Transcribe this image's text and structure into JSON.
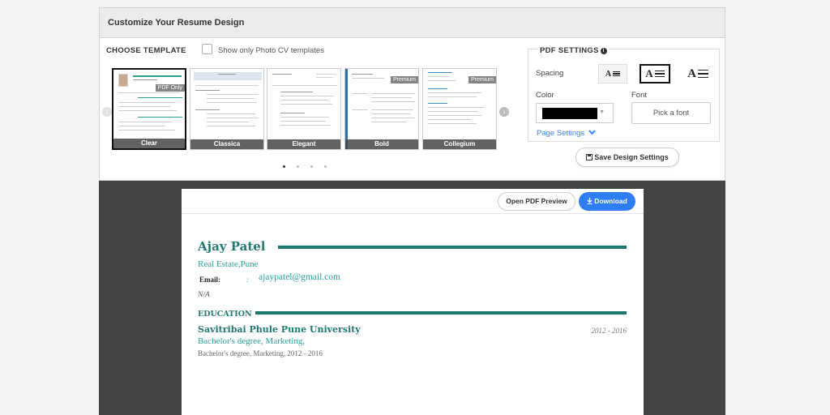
{
  "panel": {
    "title": "Customize Your Resume Design"
  },
  "templates": {
    "label": "CHOOSE TEMPLATE",
    "photo_only_label": "Show only Photo CV templates",
    "items": [
      {
        "name": "Clear",
        "badge": "PDF Only",
        "accent": "#2aa198",
        "selected": true
      },
      {
        "name": "Classica",
        "badge": "",
        "accent": "#5b7fb3",
        "selected": false
      },
      {
        "name": "Elegant",
        "badge": "",
        "accent": "#888888",
        "selected": false
      },
      {
        "name": "Bold",
        "badge": "Premium",
        "accent": "#2f6fa8",
        "selected": false
      },
      {
        "name": "Collegium",
        "badge": "Premium",
        "accent": "#3a8fd0",
        "selected": false
      }
    ],
    "pagination": {
      "pages": 4,
      "active": 1
    }
  },
  "pdf_settings": {
    "title": "PDF SETTINGS",
    "spacing_label": "Spacing",
    "spacing_options": [
      "A",
      "A",
      "A"
    ],
    "spacing_selected": 1,
    "color_label": "Color",
    "color_value": "#000000",
    "font_label": "Font",
    "font_button": "Pick a font",
    "page_settings_link": "Page Settings",
    "save_button": "Save Design Settings"
  },
  "document": {
    "preview_button": "Open PDF Preview",
    "download_button": "Download"
  },
  "resume": {
    "name": "Ajay Patel",
    "subtitle": "Real Estate,Pune",
    "email_label": "Email:",
    "email_separator": ":",
    "email": "ajaypatel@gmail.com",
    "na": "N/A",
    "education_heading": "EDUCATION",
    "university": "Savitribai Phule Pune University",
    "years": "2012 - 2016",
    "degree": "Bachelor's degree, Marketing,",
    "degree_detail": "Bachelor's degree, Marketing, 2012 - 2016",
    "accent_color": "#177a6d"
  }
}
